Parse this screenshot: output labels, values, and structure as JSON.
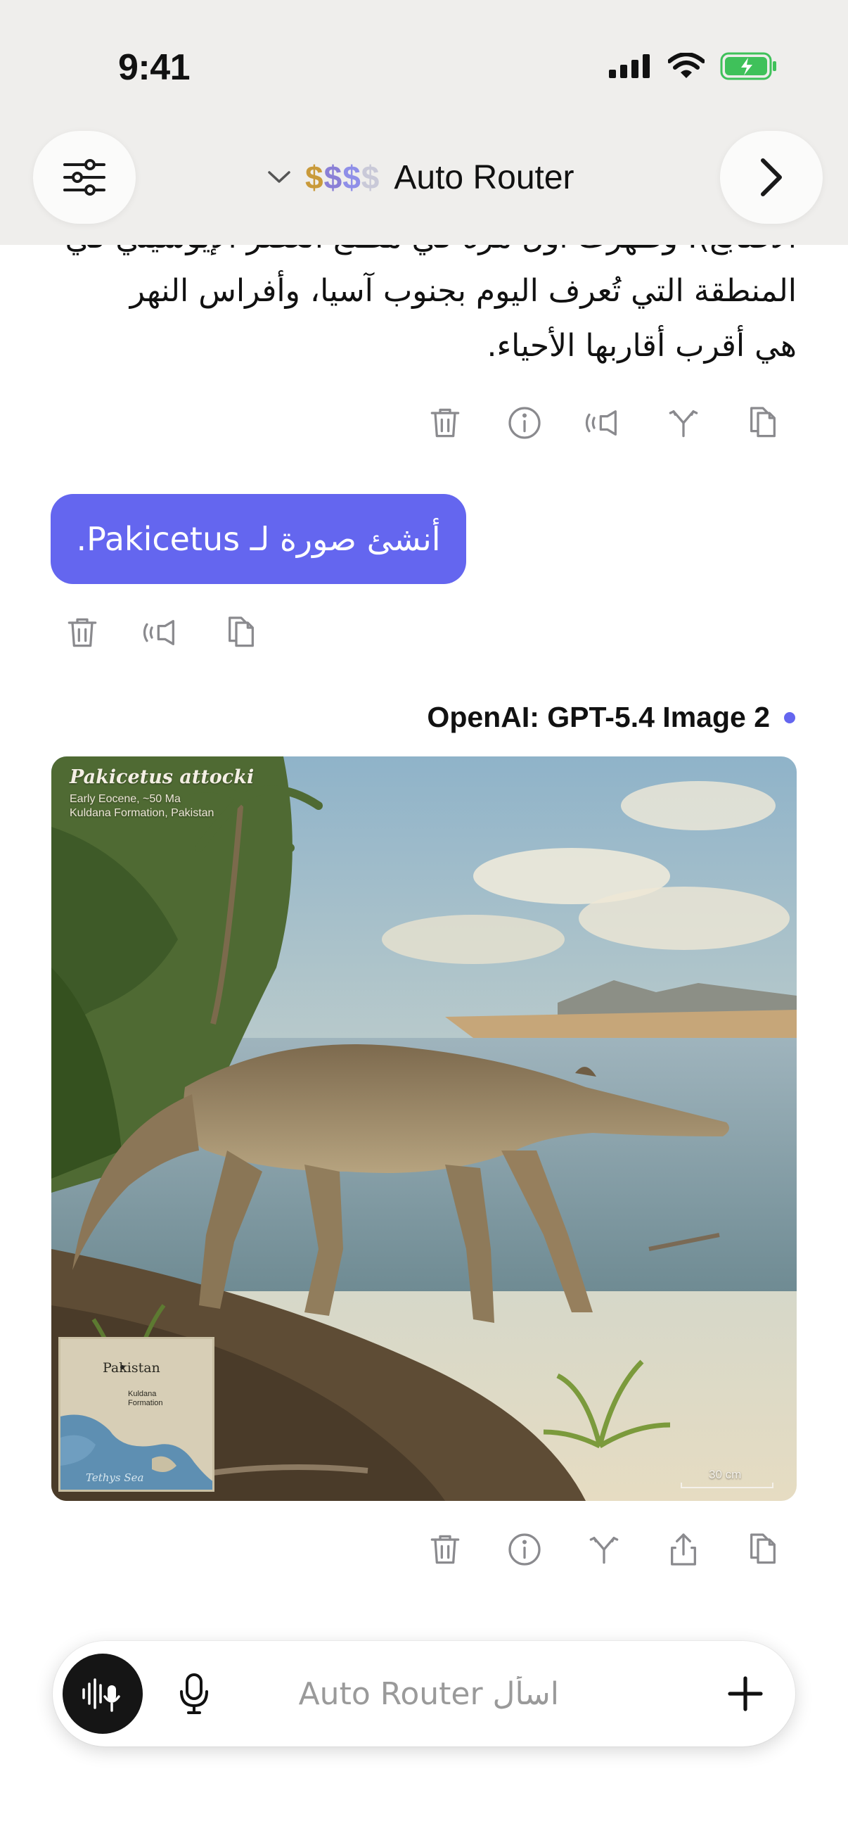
{
  "status_bar": {
    "time": "9:41"
  },
  "header": {
    "price_tier": "$$$$",
    "model_name": "Auto Router",
    "price_colors": [
      "#c99a3a",
      "#8a7fd6",
      "#8f8fe8",
      "#c9c9d8"
    ]
  },
  "assistant_message_1": {
    "lines": [
      "الأصابع)، وظهرت أول مرة في مطلع العصر الإيوسيني في",
      "المنطقة التي تُعرف اليوم بجنوب آسيا، وأفراس النهر",
      "هي أقرب أقاربها الأحياء."
    ]
  },
  "user_message": {
    "text": "أنشئ صورة لـ Pakicetus."
  },
  "assistant_message_2": {
    "model_label": "OpenAI: GPT-5.4 Image 2",
    "image": {
      "title": "Pakicetus attocki",
      "subtitle_1": "Early Eocene, ~50 Ma",
      "subtitle_2": "Kuldana Formation, Pakistan",
      "map_country": "Pakistan",
      "map_place_1": "Kuldana",
      "map_place_2": "Formation",
      "map_sea": "Tethys Sea",
      "scale": "30 cm"
    }
  },
  "composer": {
    "placeholder": "اسأل Auto Router"
  },
  "accent_color": "#6466ef"
}
